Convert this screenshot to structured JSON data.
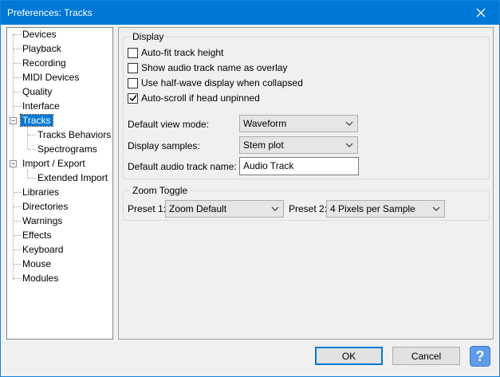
{
  "window": {
    "title": "Preferences: Tracks",
    "close_icon": "close-icon"
  },
  "tree": {
    "items": [
      {
        "label": "Devices"
      },
      {
        "label": "Playback"
      },
      {
        "label": "Recording"
      },
      {
        "label": "MIDI Devices"
      },
      {
        "label": "Quality"
      },
      {
        "label": "Interface"
      },
      {
        "label": "Tracks",
        "selected": true,
        "expanded": true
      },
      {
        "label": "Tracks Behaviors"
      },
      {
        "label": "Spectrograms"
      },
      {
        "label": "Import / Export",
        "expanded": true
      },
      {
        "label": "Extended Import"
      },
      {
        "label": "Libraries"
      },
      {
        "label": "Directories"
      },
      {
        "label": "Warnings"
      },
      {
        "label": "Effects"
      },
      {
        "label": "Keyboard"
      },
      {
        "label": "Mouse"
      },
      {
        "label": "Modules"
      }
    ]
  },
  "display": {
    "title": "Display",
    "checks": [
      {
        "label": "Auto-fit track height",
        "checked": false
      },
      {
        "label": "Show audio track name as overlay",
        "checked": false
      },
      {
        "label": "Use half-wave display when collapsed",
        "checked": false
      },
      {
        "label": "Auto-scroll if head unpinned",
        "checked": true
      }
    ],
    "view_mode_label": "Default view mode:",
    "view_mode_value": "Waveform",
    "samples_label": "Display samples:",
    "samples_value": "Stem plot",
    "track_name_label": "Default audio track name:",
    "track_name_value": "Audio Track"
  },
  "zoom": {
    "title": "Zoom Toggle",
    "preset1_label": "Preset 1:",
    "preset1_value": "Zoom Default",
    "preset2_label": "Preset 2:",
    "preset2_value": "4 Pixels per Sample"
  },
  "buttons": {
    "ok": "OK",
    "cancel": "Cancel",
    "help": "?"
  },
  "colors": {
    "accent": "#0078d7",
    "help": "#5e9cea"
  }
}
